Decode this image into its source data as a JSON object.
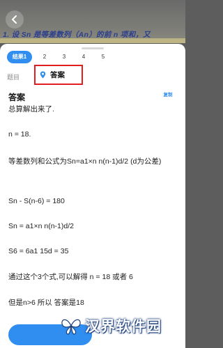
{
  "question": {
    "text": "1. 设 Sn 是等差数列（An）的前 n 项和，又"
  },
  "tabs": [
    {
      "label": "结果1",
      "active": true
    },
    {
      "label": "2",
      "active": false
    },
    {
      "label": "3",
      "active": false
    },
    {
      "label": "4",
      "active": false
    },
    {
      "label": "5",
      "active": false
    }
  ],
  "segment": {
    "topic_label": "题目",
    "answer_label": "答案"
  },
  "answer": {
    "title": "答案",
    "copy_label": "复制",
    "lines": [
      "总算解出来了.",
      "n = 18.",
      "等差数列和公式为Sn=a1×n n(n-1)d/2 (d为公差)",
      "Sn - S(n-6) = 180",
      "Sn = a1×n n(n-1)d/2",
      "S6 = 6a1 15d = 35",
      "通过这个3个式,可以解得 n = 18 或者 6",
      "但是n>6 所以 答案是18"
    ]
  },
  "watermark": {
    "text": "汉界软件园"
  },
  "colors": {
    "accent": "#2f8ef0",
    "highlight_border": "#e21d1d",
    "overlay": "#5d5d5d"
  },
  "icons": {
    "back": "chevron-left-icon",
    "answer": "map-pin-icon"
  }
}
